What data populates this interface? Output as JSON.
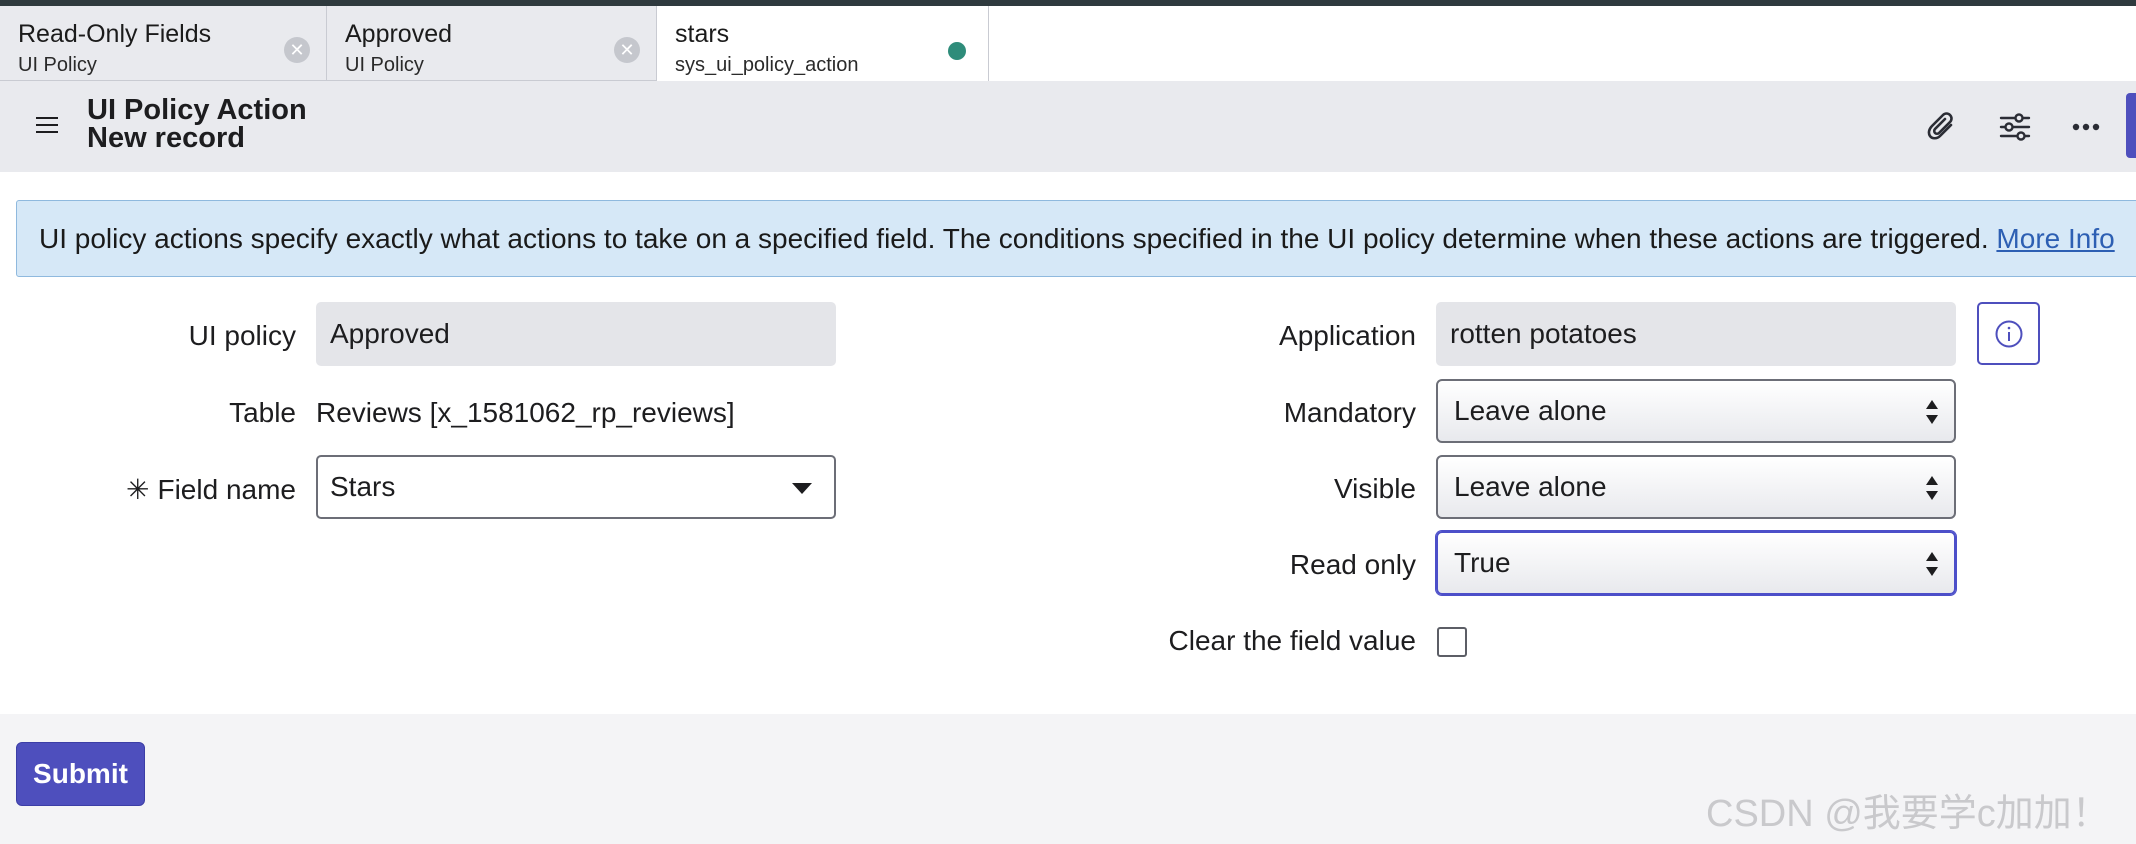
{
  "tabs": [
    {
      "title": "Read-Only Fields",
      "subtitle": "UI Policy",
      "status_icon": "close-icon"
    },
    {
      "title": "Approved",
      "subtitle": "UI Policy",
      "status_icon": "close-icon"
    },
    {
      "title": "stars",
      "subtitle": "sys_ui_policy_action",
      "status_icon": "unsaved-dot",
      "active": true
    }
  ],
  "header": {
    "title": "UI Policy Action",
    "subtitle": "New record",
    "icons": [
      "menu-icon",
      "paperclip-icon",
      "sliders-icon",
      "more-icon"
    ]
  },
  "info": {
    "text": "UI policy actions specify exactly what actions to take on a specified field. The conditions specified in the UI policy determine when these actions are triggered.",
    "link": "More Info"
  },
  "form": {
    "ui_policy": {
      "label": "UI policy",
      "value": "Approved"
    },
    "table": {
      "label": "Table",
      "value": "Reviews [x_1581062_rp_reviews]"
    },
    "field_name": {
      "label": "Field name",
      "value": "Stars",
      "required_mark": "✳"
    },
    "application": {
      "label": "Application",
      "value": "rotten potatoes"
    },
    "mandatory": {
      "label": "Mandatory",
      "value": "Leave alone"
    },
    "visible": {
      "label": "Visible",
      "value": "Leave alone"
    },
    "read_only": {
      "label": "Read only",
      "value": "True"
    },
    "clear_field_value": {
      "label": "Clear the field value",
      "checked": false
    }
  },
  "footer": {
    "submit_label": "Submit"
  },
  "watermark": "CSDN @我要学c加加！",
  "colors": {
    "accent": "#4e4fbd",
    "info_bg": "#d6e8f7",
    "link": "#2d5fb3",
    "unsaved_dot": "#2e8c7a"
  }
}
